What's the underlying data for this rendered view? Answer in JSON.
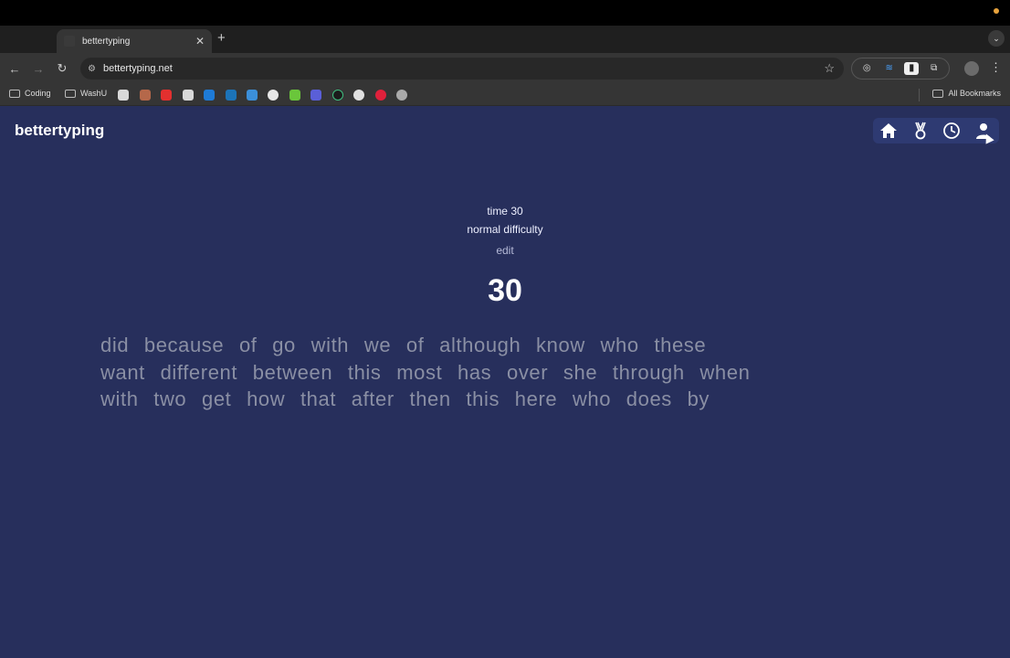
{
  "browser": {
    "tab_title": "bettertyping",
    "url": "bettertyping.net",
    "bookmarks": [
      {
        "label": "Coding"
      },
      {
        "label": "WashU"
      }
    ],
    "all_bookmarks_label": "All Bookmarks"
  },
  "app": {
    "logo": "bettertyping",
    "nav_icons": [
      "home-icon",
      "medal-icon",
      "clock-icon",
      "user-icon"
    ],
    "accent": "#2e3a72",
    "background": "#272f5c"
  },
  "test": {
    "mode": "time 30",
    "difficulty": "normal difficulty",
    "edit_label": "edit",
    "timer": "30",
    "lines": [
      "did because of go with we of although know who these",
      "want different between this most has over she through when",
      "with two get how that after then this here who does by"
    ]
  }
}
